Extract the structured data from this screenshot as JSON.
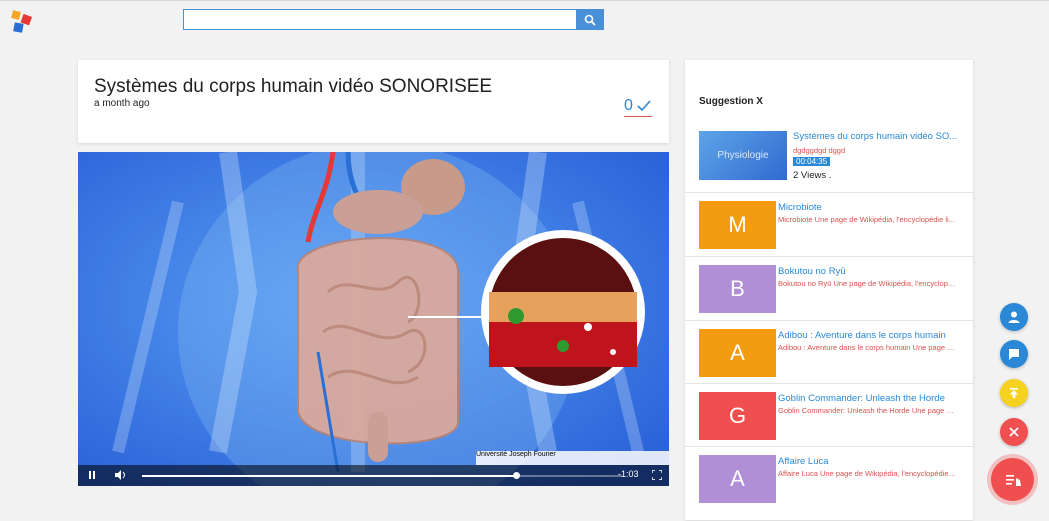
{
  "search": {
    "placeholder": "",
    "value": ""
  },
  "video": {
    "title": "Systèmes du corps humain vidéo SONORISEE",
    "date": "a month ago",
    "likes": "0",
    "time_remaining": "-1:03",
    "progress": 0.78,
    "badge_text": "Université Joseph Fourier"
  },
  "sidebar": {
    "heading": "Suggestion X",
    "items": [
      {
        "title": "Systèmes du corps humain vidéo SO...",
        "desc": "dgdggdgd dggd",
        "duration": "00:04:35",
        "views": "2 Views .",
        "thumb_label": "Physiologie"
      },
      {
        "letter": "M",
        "color": "#f39c12",
        "title": "Microbiote",
        "desc": "Microbiote Une page de Wikipédia, l'encyclopédie li..."
      },
      {
        "letter": "B",
        "color": "#b08fd6",
        "title": "Bokutou no Ryū",
        "desc": "Bokutou no Ryū Une page de Wikipédia, l'encyclopédie li..."
      },
      {
        "letter": "A",
        "color": "#f39c12",
        "title": "Adibou : Aventure dans le corps humain",
        "desc": "Adibou : Aventure dans le corps humain Une page de..."
      },
      {
        "letter": "G",
        "color": "#ef4f4f",
        "title": "Goblin Commander: Unleash the Horde",
        "desc": "Goblin Commander: Unleash the Horde Une page de..."
      },
      {
        "letter": "A",
        "color": "#b08fd6",
        "title": "Affaire Luca",
        "desc": "Affaire Luca Une page de Wikipédia, l'encyclopédie li..."
      }
    ]
  },
  "fab": {
    "colors": {
      "profile": "#2a88d6",
      "chat": "#2a88d6",
      "upload": "#f5d21f",
      "close": "#ef4f4f",
      "menu": "#ef4f4f"
    }
  }
}
